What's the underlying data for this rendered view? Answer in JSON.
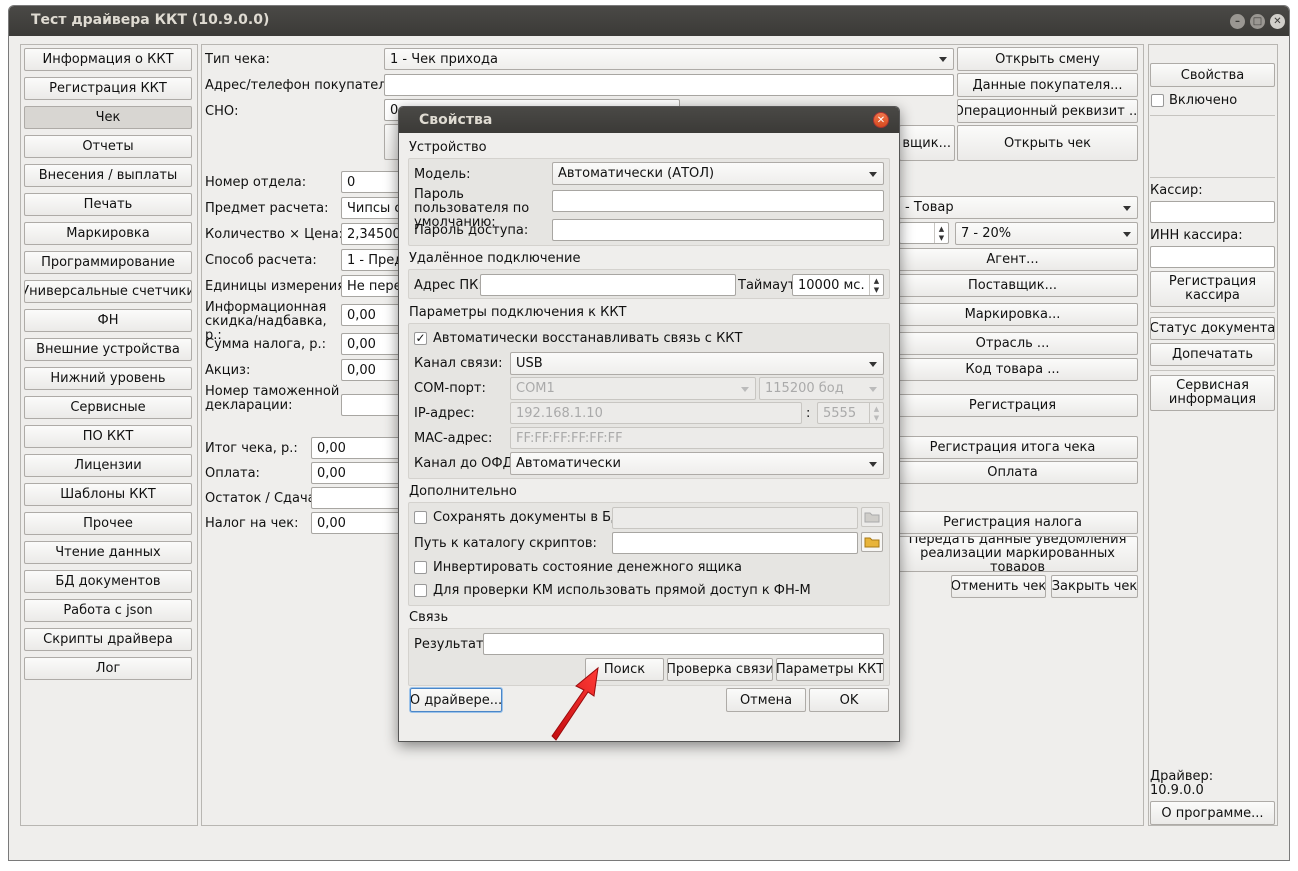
{
  "window": {
    "title": "Тест драйвера ККТ (10.9.0.0)"
  },
  "nav": [
    "Информация о ККТ",
    "Регистрация ККТ",
    "Чек",
    "Отчеты",
    "Внесения / выплаты",
    "Печать",
    "Маркировка",
    "Программирование",
    "Универсальные счетчики",
    "ФН",
    "Внешние устройства",
    "Нижний уровень",
    "Сервисные",
    "ПО ККТ",
    "Лицензии",
    "Шаблоны ККТ",
    "Прочее",
    "Чтение данных",
    "БД документов",
    "Работа с json",
    "Скрипты драйвера",
    "Лог"
  ],
  "nav_selected": 2,
  "check": {
    "type_label": "Тип чека:",
    "type_value": "1 - Чек прихода",
    "buyer_label": "Адрес/телефон покупателя:",
    "buyer_value": "",
    "sno_label": "СНО:",
    "sno_value": "0",
    "btn_open_shift": "Открыть смену",
    "btn_buyer_data": "Данные покупателя...",
    "btn_op_req": "Операционный реквизит ...",
    "btn_supplier_partial": "вщик...",
    "btn_open_check": "Открыть чек",
    "dept_label": "Номер отдела:",
    "dept_value": "0",
    "subject_label": "Предмет расчета:",
    "subject_value": "Чипсы с",
    "subject_type_value": "- Товар",
    "qty_label": "Количество × Цена:",
    "qty_value": "2,34500",
    "vat_value": "7 - 20%",
    "method_label": "Способ расчета:",
    "method_value": "1 - Пред",
    "units_label": "Единицы измерения:",
    "units_value": "Не перед",
    "discount_label": "Информационная скидка/надбавка, р.:",
    "discount_value": "0,00",
    "tax_sum_label": "Сумма налога, р.:",
    "tax_sum_value": "0,00",
    "excise_label": "Акциз:",
    "excise_value": "0,00",
    "customs_label": "Номер таможенной декларации:",
    "btn_agent": "Агент...",
    "btn_supplier": "Поставщик...",
    "btn_marking": "Маркировка...",
    "btn_industry": "Отрасль ...",
    "btn_product_code": "Код товара ...",
    "btn_registration": "Регистрация",
    "total_label": "Итог чека, р.:",
    "total_value": "0,00",
    "payment_label": "Оплата:",
    "payment_value": "0,00",
    "change_label": "Остаток / Сдача:",
    "tax_label": "Налог на чек:",
    "tax_value": "0,00",
    "btn_reg_total": "Регистрация итога чека",
    "btn_payment": "Оплата",
    "btn_reg_tax": "Регистрация налога",
    "btn_notify": "Передать данные уведомления реализации маркированных товаров",
    "btn_cancel_check": "Отменить чек",
    "btn_close_check": "Закрыть чек"
  },
  "right": {
    "btn_properties": "Свойства",
    "enabled_label": "Включено",
    "cashier_label": "Кассир:",
    "inn_label": "ИНН кассира:",
    "btn_reg_cashier": "Регистрация кассира",
    "btn_doc_status": "Статус документа",
    "btn_reprint": "Допечатать",
    "btn_service_info": "Сервисная информация",
    "driver_label": "Драйвер:",
    "driver_version": "10.9.0.0",
    "btn_about": "О программе..."
  },
  "dialog": {
    "title": "Свойства",
    "device_section": "Устройство",
    "model_label": "Модель:",
    "model_value": "Автоматически (АТОЛ)",
    "user_pass_label": "Пароль пользователя по умолчанию:",
    "access_pass_label": "Пароль доступа:",
    "remote_section": "Удалённое подключение",
    "pc_addr_label": "Адрес ПК:",
    "timeout_label": "Таймаут",
    "timeout_value": "10000 мс.",
    "conn_section": "Параметры подключения к ККТ",
    "auto_restore_label": "Автоматически восстанавливать связь с ККТ",
    "channel_label": "Канал связи:",
    "channel_value": "USB",
    "com_label": "COM-порт:",
    "com_value": "COM1",
    "baud_value": "115200 бод",
    "ip_label": "IP-адрес:",
    "ip_value": "192.168.1.10",
    "ip_sep": ":",
    "port_value": "5555",
    "mac_label": "MAC-адрес:",
    "mac_value": "FF:FF:FF:FF:FF:FF",
    "ofd_label": "Канал до ОФД:",
    "ofd_value": "Автоматически",
    "extra_section": "Дополнительно",
    "save_docs_label": "Сохранять документы в БД",
    "scripts_label": "Путь к каталогу скриптов:",
    "invert_label": "Инвертировать состояние денежного ящика",
    "km_label": "Для проверки КМ использовать прямой доступ к ФН-М",
    "link_section": "Связь",
    "result_label": "Результат:",
    "btn_search": "Поиск",
    "btn_check_link": "Проверка связи",
    "btn_kkt_params": "Параметры ККТ",
    "btn_about_driver": "О драйвере...",
    "btn_cancel": "Отмена",
    "btn_ok": "OK"
  },
  "colors": {
    "accent_arrow": "#e4161b",
    "titlebar": "#3f3e3b"
  }
}
